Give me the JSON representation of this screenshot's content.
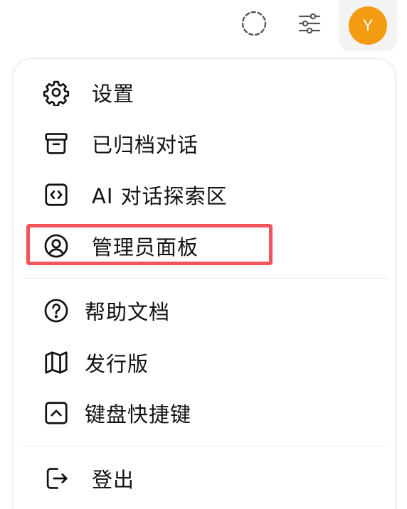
{
  "topbar": {
    "avatar_letter": "Y",
    "avatar_color": "#f39c12",
    "icons": [
      "dashed-circle-icon",
      "sliders-icon"
    ]
  },
  "menu": {
    "items": [
      {
        "label": "设置",
        "icon": "gear-icon"
      },
      {
        "label": "已归档对话",
        "icon": "archive-box-icon"
      },
      {
        "label": "AI 对话探索区",
        "icon": "code-bracket-icon"
      },
      {
        "label": "管理员面板",
        "icon": "user-circle-icon"
      },
      {
        "label": "帮助文档",
        "icon": "question-circle-icon"
      },
      {
        "label": "发行版",
        "icon": "map-icon"
      },
      {
        "label": "键盘快捷键",
        "icon": "keyboard-up-icon"
      },
      {
        "label": "登出",
        "icon": "sign-out-icon"
      }
    ],
    "highlight_color": "#f0555a"
  }
}
